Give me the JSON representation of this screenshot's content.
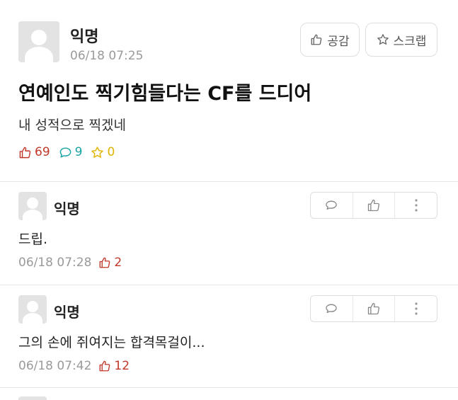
{
  "post": {
    "author": "익명",
    "timestamp": "06/18 07:25",
    "like_button_label": "공감",
    "scrap_button_label": "스크랩",
    "title": "연예인도 찍기힘들다는 CF를 드디어",
    "body": "내 성적으로 찍겠네",
    "stats": {
      "likes": "69",
      "comments": "9",
      "scraps": "0"
    }
  },
  "comments": [
    {
      "author": "익명",
      "text": "드립.",
      "timestamp": "06/18 07:28",
      "likes": "2"
    },
    {
      "author": "익명",
      "text": "그의 손에 쥐여지는 합격목걸이...",
      "timestamp": "06/18 07:42",
      "likes": "12"
    }
  ],
  "colors": {
    "like": "#c0392b",
    "comment": "#1aa3a3",
    "scrap": "#e0b400",
    "meta": "#9a9a9a",
    "border": "#dedede"
  },
  "icons": {
    "like": "thumbs-up-icon",
    "comment": "speech-bubble-icon",
    "scrap": "star-icon",
    "more": "more-vertical-icon"
  }
}
